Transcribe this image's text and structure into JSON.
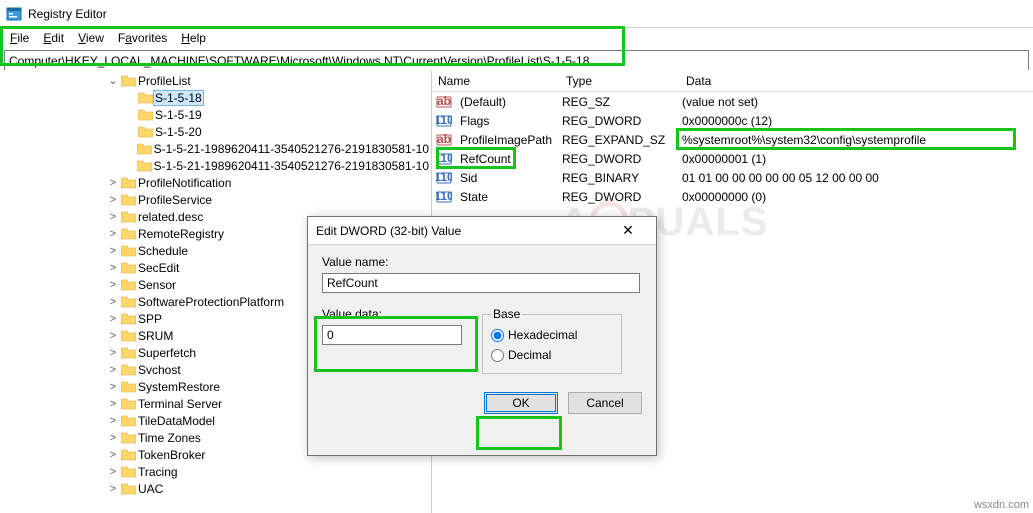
{
  "window": {
    "title": "Registry Editor"
  },
  "menu": {
    "file": "File",
    "edit": "Edit",
    "view": "View",
    "favorites": "Favorites",
    "help": "Help"
  },
  "address": "Computer\\HKEY_LOCAL_MACHINE\\SOFTWARE\\Microsoft\\Windows NT\\CurrentVersion\\ProfileList\\S-1-5-18",
  "tree": {
    "root": "ProfileList",
    "children": [
      "S-1-5-18",
      "S-1-5-19",
      "S-1-5-20",
      "S-1-5-21-1989620411-3540521276-2191830581-10",
      "S-1-5-21-1989620411-3540521276-2191830581-10"
    ],
    "siblings": [
      "ProfileNotification",
      "ProfileService",
      "related.desc",
      "RemoteRegistry",
      "Schedule",
      "SecEdit",
      "Sensor",
      "SoftwareProtectionPlatform",
      "SPP",
      "SRUM",
      "Superfetch",
      "Svchost",
      "SystemRestore",
      "Terminal Server",
      "TileDataModel",
      "Time Zones",
      "TokenBroker",
      "Tracing",
      "UAC"
    ],
    "selected": "S-1-5-18"
  },
  "list": {
    "headers": {
      "name": "Name",
      "type": "Type",
      "data": "Data"
    },
    "rows": [
      {
        "icon": "ab",
        "name": "(Default)",
        "type": "REG_SZ",
        "data": "(value not set)"
      },
      {
        "icon": "num",
        "name": "Flags",
        "type": "REG_DWORD",
        "data": "0x0000000c (12)"
      },
      {
        "icon": "ab",
        "name": "ProfileImagePath",
        "type": "REG_EXPAND_SZ",
        "data": "%systemroot%\\system32\\config\\systemprofile"
      },
      {
        "icon": "num",
        "name": "RefCount",
        "type": "REG_DWORD",
        "data": "0x00000001 (1)"
      },
      {
        "icon": "num",
        "name": "Sid",
        "type": "REG_BINARY",
        "data": "01 01 00 00 00 00 00 05 12 00 00 00"
      },
      {
        "icon": "num",
        "name": "State",
        "type": "REG_DWORD",
        "data": "0x00000000 (0)"
      }
    ]
  },
  "dialog": {
    "title": "Edit DWORD (32-bit) Value",
    "value_name_label": "Value name:",
    "value_name": "RefCount",
    "value_data_label": "Value data:",
    "value_data": "0",
    "base_label": "Base",
    "hex_label": "Hexadecimal",
    "dec_label": "Decimal",
    "ok": "OK",
    "cancel": "Cancel"
  },
  "watermark": "A  PUALS",
  "credit": "wsxdn.com"
}
